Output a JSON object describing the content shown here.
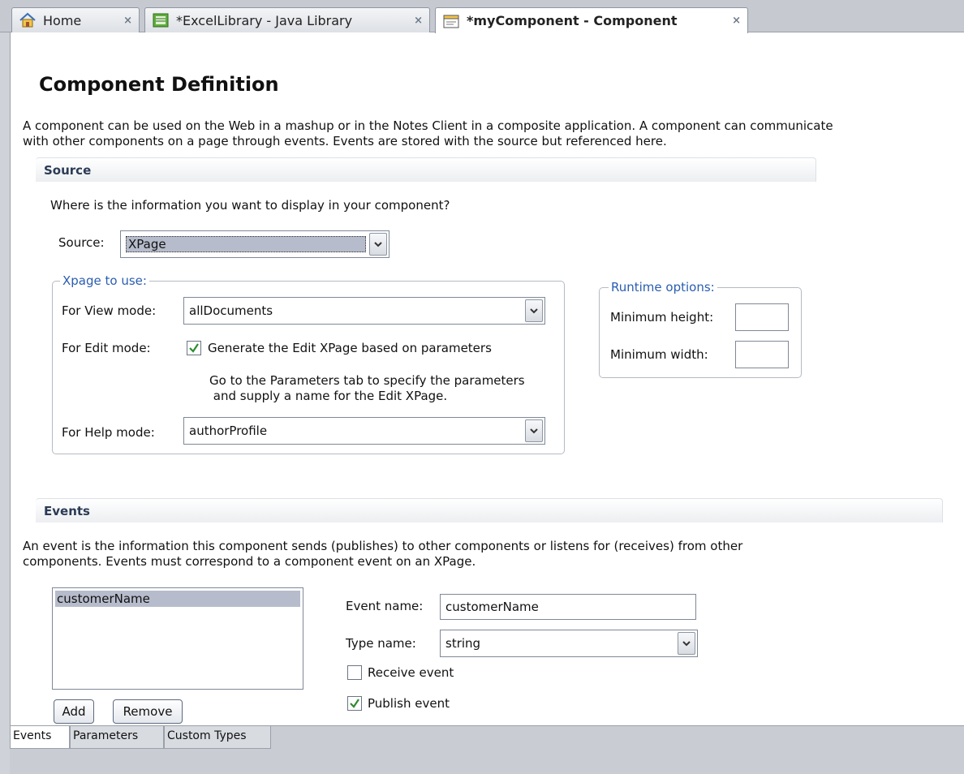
{
  "tabs": [
    {
      "label": "Home",
      "icon": "home-icon",
      "close": "×"
    },
    {
      "label": "*ExcelLibrary - Java Library",
      "icon": "java-library-icon",
      "close": "×"
    },
    {
      "label": "*myComponent - Component",
      "icon": "component-icon",
      "close": "×"
    }
  ],
  "page": {
    "title": "Component Definition",
    "intro_line1": "A component can be used on the Web in a mashup or in the Notes Client in a composite application. A component can communicate",
    "intro_line2": "with other components on a page through events. Events are stored with the source but referenced here."
  },
  "source": {
    "section_title": "Source",
    "question": "Where is the information you want to display in your component?",
    "source_label": "Source:",
    "source_value": "XPage",
    "xpage_group_title": "Xpage to use:",
    "view_mode_label": "For View mode:",
    "view_mode_value": "allDocuments",
    "edit_mode_label": "For Edit mode:",
    "edit_mode_checkbox_label": "Generate the Edit XPage based on parameters",
    "edit_mode_checked": true,
    "edit_note_line1": "Go to the Parameters tab to specify the parameters",
    "edit_note_line2": " and supply a name for the Edit XPage.",
    "help_mode_label": "For Help mode:",
    "help_mode_value": "authorProfile",
    "runtime_group_title": "Runtime options:",
    "min_height_label": "Minimum height:",
    "min_height_value": "",
    "min_width_label": "Minimum width:",
    "min_width_value": ""
  },
  "events": {
    "section_title": "Events",
    "desc_line1": "An event is the information this component sends (publishes) to other components or listens for (receives) from other",
    "desc_line2": "components. Events must correspond to a component event on an XPage.",
    "list": [
      "customerName"
    ],
    "add_label": "Add",
    "remove_label": "Remove",
    "event_name_label": "Event name:",
    "event_name_value": "customerName",
    "type_name_label": "Type name:",
    "type_name_value": "string",
    "receive_label": "Receive event",
    "receive_checked": false,
    "publish_label": "Publish event",
    "publish_checked": true
  },
  "bottom_tabs": [
    "Events",
    "Parameters",
    "Custom Types"
  ],
  "colors": {
    "accent_blue": "#2a5db0",
    "check_green": "#2e8b2e",
    "selection": "#b6bccb"
  }
}
